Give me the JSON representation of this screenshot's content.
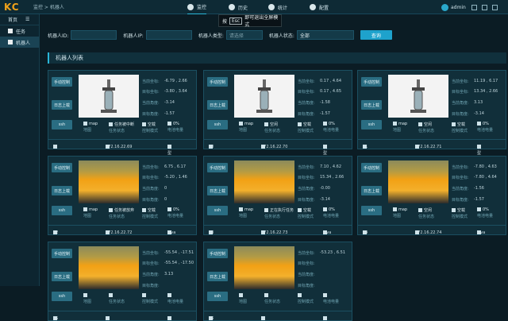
{
  "app": {
    "logo": "KC",
    "breadcrumb": "监控  >  机器人"
  },
  "nav": [
    {
      "label": "监控",
      "icon": "monitor-icon",
      "active": true
    },
    {
      "label": "历史",
      "icon": "history-icon"
    },
    {
      "label": "统计",
      "icon": "chart-icon"
    },
    {
      "label": "配置",
      "icon": "settings-icon"
    }
  ],
  "tooltip": {
    "prefix": "按",
    "key": "Esc",
    "text": "即可退出全屏模式"
  },
  "user": {
    "name": "admin"
  },
  "sidebar": {
    "items": [
      {
        "label": "首页"
      },
      {
        "label": "任务"
      },
      {
        "label": "机器人"
      }
    ]
  },
  "filters": {
    "robot_id_label": "机器人ID:",
    "robot_ip_label": "机器人IP:",
    "robot_type_label": "机器人类型:",
    "robot_type_value": "请选择",
    "robot_status_label": "机器人状态:",
    "robot_status_value": "全部",
    "query_button": "查询"
  },
  "list_title": "机器人列表",
  "card_labels": {
    "manual": "手动控制",
    "log": "日志上载",
    "ssh": "ssh",
    "current": "当前坐标:",
    "target": "目标坐标:",
    "current_angle": "当前角度:",
    "target_angle": "目标角度:",
    "map_sub": "地图",
    "task_sub": "任务状态",
    "ctrl_sub": "控制模式",
    "battery_sub": "电池电量"
  },
  "robots": [
    {
      "id": "9",
      "ip": "172.16.22.69",
      "model": "模型1",
      "image": "robot-arm",
      "cur": "-6.79 , 2.66",
      "tgt": "-3.80 , 3.64",
      "cang": "-3.14",
      "tang": "-1.57",
      "map": "map",
      "task": "任务被中断",
      "ctrl": "空载",
      "battery": "0%"
    },
    {
      "id": "10",
      "ip": "172.16.22.70",
      "model": "模型1",
      "image": "robot-arm",
      "cur": "0.17 , 4.64",
      "tgt": "0.17 , 4.65",
      "cang": "-1.58",
      "tang": "-1.57",
      "map": "map",
      "task": "空闲",
      "ctrl": "空载",
      "battery": "0%"
    },
    {
      "id": "11",
      "ip": "172.16.22.71",
      "model": "模型1",
      "image": "robot-arm",
      "cur": "11.19 , 6.17",
      "tgt": "13.34 , 2.66",
      "cang": "3.13",
      "tang": "-3.14",
      "map": "map",
      "task": "空闲",
      "ctrl": "空载",
      "battery": "0%"
    },
    {
      "id": "12",
      "ip": "172.16.22.72",
      "model": "kiva",
      "image": "agv",
      "cur": "6.75 , 6.17",
      "tgt": "-5.20 , 1.46",
      "cang": "0",
      "tang": "0",
      "map": "map",
      "task": "任务被放弃",
      "ctrl": "空载",
      "battery": "0%"
    },
    {
      "id": "13",
      "ip": "172.16.22.73",
      "model": "kiva",
      "image": "agv",
      "cur": "7.10 , 4.62",
      "tgt": "15.34 , 2.66",
      "cang": "-0.00",
      "tang": "-3.14",
      "map": "map",
      "task": "正在执行任务",
      "ctrl": "空载",
      "battery": "0%"
    },
    {
      "id": "14",
      "ip": "172.16.22.74",
      "model": "kiva",
      "image": "agv",
      "cur": "-7.80 , 4.63",
      "tgt": "-7.80 , 4.64",
      "cang": "-1.56",
      "tang": "-1.57",
      "map": "map",
      "task": "空闲",
      "ctrl": "空载",
      "battery": "0%"
    },
    {
      "id": "15",
      "ip": "",
      "model": "",
      "image": "agv",
      "cur": "-55.54 , -17.51",
      "tgt": "-55.54 , -17.50",
      "cang": "3.13",
      "tang": "",
      "map": "",
      "task": "",
      "ctrl": "",
      "battery": ""
    },
    {
      "id": "16",
      "ip": "",
      "model": "",
      "image": "agv",
      "cur": "-53.23 , 6.51",
      "tgt": "",
      "cang": "",
      "tang": "",
      "map": "",
      "task": "",
      "ctrl": "",
      "battery": ""
    }
  ],
  "colors": {
    "accent": "#29b6d8",
    "logo": "#f0a21a",
    "bg": "#0b1c24"
  }
}
